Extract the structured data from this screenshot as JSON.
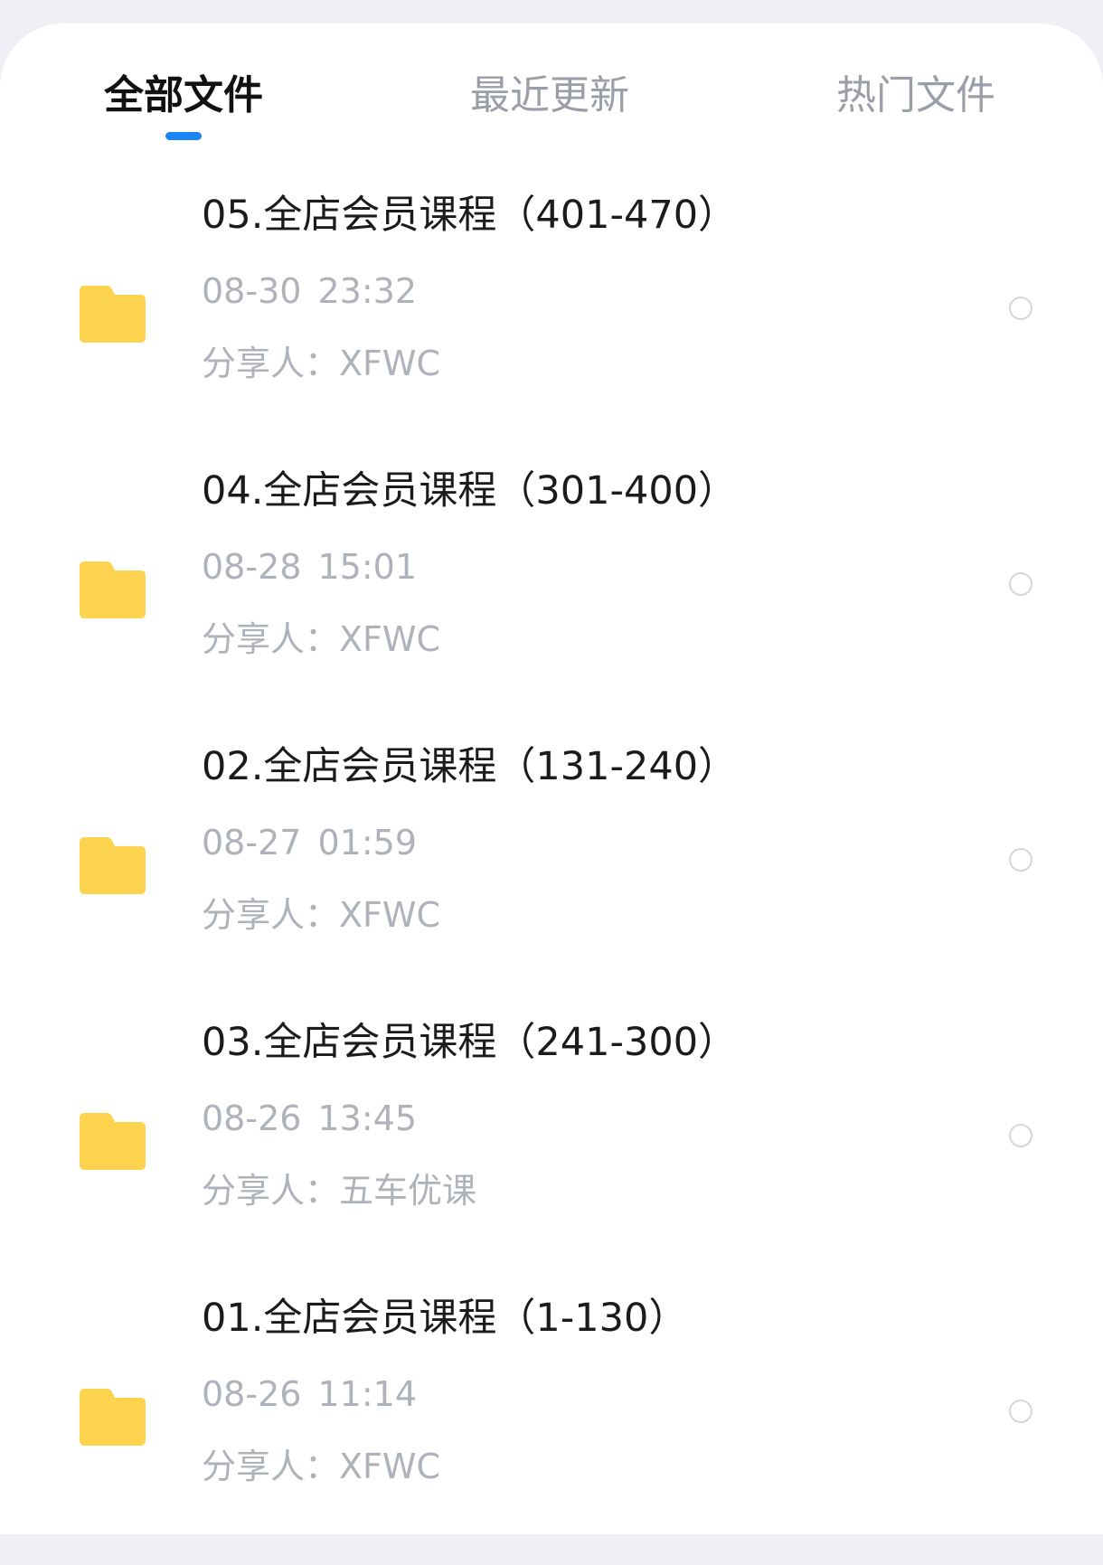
{
  "tabs": [
    {
      "label": "全部文件"
    },
    {
      "label": "最近更新"
    },
    {
      "label": "热门文件"
    }
  ],
  "colors": {
    "accent": "#1a86f5",
    "folder": "#fcd34f",
    "title_text": "#1b1b1b",
    "meta_text": "#aeb2ba"
  },
  "files": [
    {
      "icon": "folder-icon",
      "name": "05.全店会员课程（401-470）",
      "time": "08-30 23:32",
      "sharer": "分享人：XFWC"
    },
    {
      "icon": "folder-icon",
      "name": "04.全店会员课程（301-400）",
      "time": "08-28 15:01",
      "sharer": "分享人：XFWC"
    },
    {
      "icon": "folder-icon",
      "name": "02.全店会员课程（131-240）",
      "time": "08-27 01:59",
      "sharer": "分享人：XFWC"
    },
    {
      "icon": "folder-icon",
      "name": "03.全店会员课程（241-300）",
      "time": "08-26 13:45",
      "sharer": "分享人：五车优课"
    },
    {
      "icon": "folder-icon",
      "name": "01.全店会员课程（1-130）",
      "time": "08-26 11:14",
      "sharer": "分享人：XFWC"
    }
  ]
}
